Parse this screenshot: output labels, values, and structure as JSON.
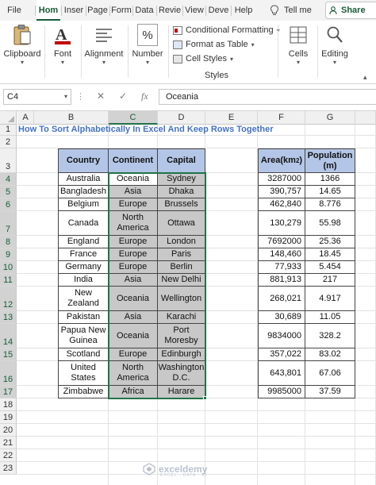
{
  "ribbon_tabs": [
    {
      "label": "File",
      "active": false
    },
    {
      "label": "Hom",
      "active": true
    },
    {
      "label": "Inser",
      "active": false
    },
    {
      "label": "Page",
      "active": false
    },
    {
      "label": "Form",
      "active": false
    },
    {
      "label": "Data",
      "active": false
    },
    {
      "label": "Revie",
      "active": false
    },
    {
      "label": "View",
      "active": false
    },
    {
      "label": "Deve",
      "active": false
    },
    {
      "label": "Help",
      "active": false
    }
  ],
  "tell_me": "Tell me",
  "share": "Share",
  "ribbon": {
    "clipboard": "Clipboard",
    "font": "Font",
    "alignment": "Alignment",
    "number": "Number",
    "number_symbol": "%",
    "conditional_formatting": "Conditional Formatting",
    "format_as_table": "Format as Table",
    "cell_styles": "Cell Styles",
    "styles_group": "Styles",
    "cells": "Cells",
    "editing": "Editing"
  },
  "formula_bar": {
    "name_box": "C4",
    "fx": "fx",
    "content": "Oceania"
  },
  "columns": [
    "A",
    "B",
    "C",
    "D",
    "E",
    "F",
    "G"
  ],
  "rows": [
    "1",
    "2",
    "3",
    "4",
    "5",
    "6",
    "7",
    "8",
    "9",
    "10",
    "11",
    "12",
    "13",
    "14",
    "15",
    "16",
    "17",
    "18",
    "19",
    "20",
    "21",
    "22",
    "23"
  ],
  "sheet": {
    "title": "How To Sort Alphabetically In Excel And Keep Rows Together",
    "headers": {
      "country": "Country",
      "continent": "Continent",
      "capital": "Capital",
      "area": "Area(km",
      "area_sup": "2",
      "area_close": ")",
      "population": "Population (m)"
    },
    "table": [
      {
        "country": "Australia",
        "continent": "Oceania",
        "capital": "Sydney",
        "area": "3287000",
        "population": "1366"
      },
      {
        "country": "Bangladesh",
        "continent": "Asia",
        "capital": "Dhaka",
        "area": "390,757",
        "population": "14.65"
      },
      {
        "country": "Belgium",
        "continent": "Europe",
        "capital": "Brussels",
        "area": "462,840",
        "population": "8.776"
      },
      {
        "country": "Canada",
        "continent": "North America",
        "capital": "Ottawa",
        "area": "130,279",
        "population": "55.98"
      },
      {
        "country": "England",
        "continent": "Europe",
        "capital": "London",
        "area": "7692000",
        "population": "25.36"
      },
      {
        "country": "France",
        "continent": "Europe",
        "capital": "Paris",
        "area": "148,460",
        "population": "18.45"
      },
      {
        "country": "Germany",
        "continent": "Europe",
        "capital": "Berlin",
        "area": "77,933",
        "population": "5.454"
      },
      {
        "country": "India",
        "continent": "Asia",
        "capital": "New Delhi",
        "area": "881,913",
        "population": "217"
      },
      {
        "country": "New Zealand",
        "continent": "Oceania",
        "capital": "Wellington",
        "area": "268,021",
        "population": "4.917"
      },
      {
        "country": "Pakistan",
        "continent": "Asia",
        "capital": "Karachi",
        "area": "30,689",
        "population": "11.05"
      },
      {
        "country": "Papua New Guinea",
        "continent": "Oceania",
        "capital": "Port Moresby",
        "area": "9834000",
        "population": "328.2"
      },
      {
        "country": "Scotland",
        "continent": "Europe",
        "capital": "Edinburgh",
        "area": "357,022",
        "population": "83.02"
      },
      {
        "country": "United States",
        "continent": "North America",
        "capital": "Washington D.C.",
        "area": "643,801",
        "population": "67.06"
      },
      {
        "country": "Zimbabwe",
        "continent": "Africa",
        "capital": "Harare",
        "area": "9985000",
        "population": "37.59"
      }
    ]
  },
  "watermark": {
    "name": "exceldemy",
    "tagline": "EXCEL · DATA · BI"
  },
  "colors": {
    "excel_green": "#217346",
    "header_fill": "#b4c6e7",
    "selected_fill": "#c8c8c8",
    "country_text": "#44962b",
    "number_text": "#c00000",
    "title_text": "#4472c4"
  }
}
